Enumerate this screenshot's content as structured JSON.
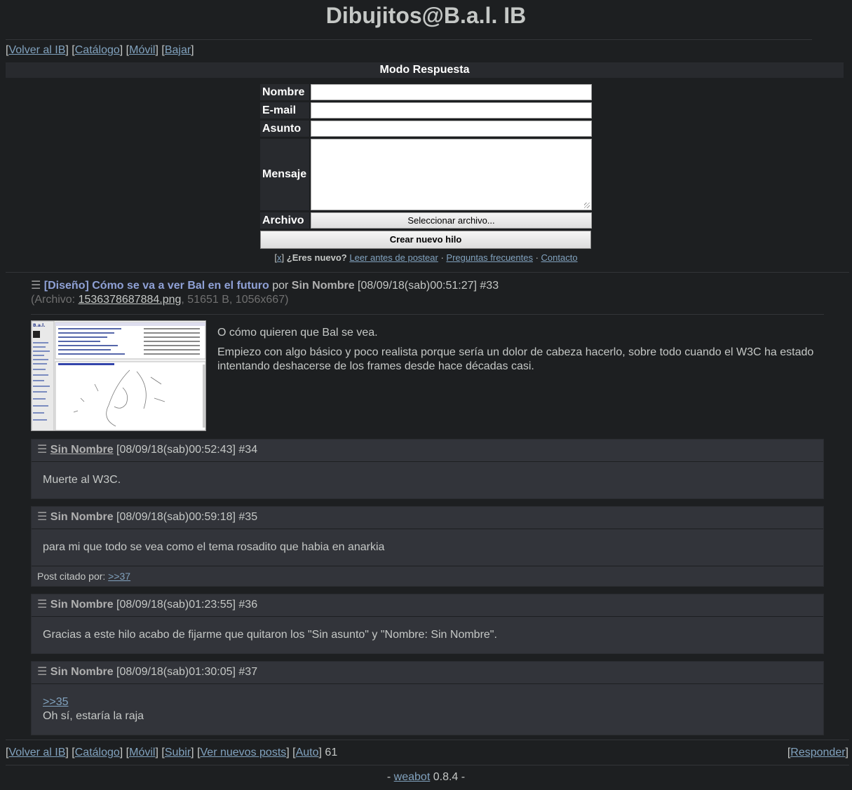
{
  "site_title": "Dibujitos@B.a.l. IB",
  "nav_top": [
    "Volver al IB",
    "Catálogo",
    "Móvil",
    "Bajar"
  ],
  "mode_label": "Modo Respuesta",
  "form": {
    "name_label": "Nombre",
    "email_label": "E-mail",
    "subject_label": "Asunto",
    "message_label": "Mensaje",
    "file_label": "Archivo",
    "file_button": "Seleccionar archivo...",
    "submit": "Crear nuevo hilo"
  },
  "rules": {
    "close": "x",
    "new_q": "¿Eres nuevo?",
    "read_before": "Leer antes de postear",
    "faq": "Preguntas frecuentes",
    "contact": "Contacto"
  },
  "op": {
    "menu_icon": "☰",
    "subject": "[Diseño] Cómo se va a ver Bal en el futuro",
    "by": "por",
    "name": "Sin Nombre",
    "date": "[08/09/18(sab)00:51:27]",
    "num": "#33",
    "file_prefix": "(Archivo:",
    "file_name": "1536378687884.png",
    "file_meta": ", 51651 B, 1056x667)",
    "message_1": "O cómo quieren que Bal se vea.",
    "message_2": "Empiezo con algo básico y poco realista porque sería un dolor de cabeza hacerlo, sobre todo cuando el W3C ha estado intentando deshacerse de los frames desde hace décadas casi."
  },
  "replies": [
    {
      "name": "Sin Nombre",
      "date": "[08/09/18(sab)00:52:43]",
      "num": "#34",
      "message": "Muerte al W3C."
    },
    {
      "name": "Sin Nombre",
      "date": "[08/09/18(sab)00:59:18]",
      "num": "#35",
      "message": "para mi que todo se vea como el tema rosadito que habia en anarkia",
      "cited_label": "Post citado por:",
      "cited_link": ">>37"
    },
    {
      "name": "Sin Nombre",
      "date": "[08/09/18(sab)01:23:55]",
      "num": "#36",
      "message": "Gracias a este hilo acabo de fijarme que quitaron los \"Sin asunto\" y \"Nombre: Sin Nombre\"."
    },
    {
      "name": "Sin Nombre",
      "date": "[08/09/18(sab)01:30:05]",
      "num": "#37",
      "quote": ">>35",
      "message": "Oh sí, estaría la raja"
    }
  ],
  "nav_bottom": [
    "Volver al IB",
    "Catálogo",
    "Móvil",
    "Subir",
    "Ver nuevos posts",
    "Auto"
  ],
  "auto_count": "61",
  "respond": "Responder",
  "footer_link": "weabot",
  "footer_version": "0.8.4",
  "colors": {
    "background": "#1d1f21",
    "text": "#c5c8c6",
    "link": "#81a2be",
    "reply_bg": "#32343a"
  }
}
